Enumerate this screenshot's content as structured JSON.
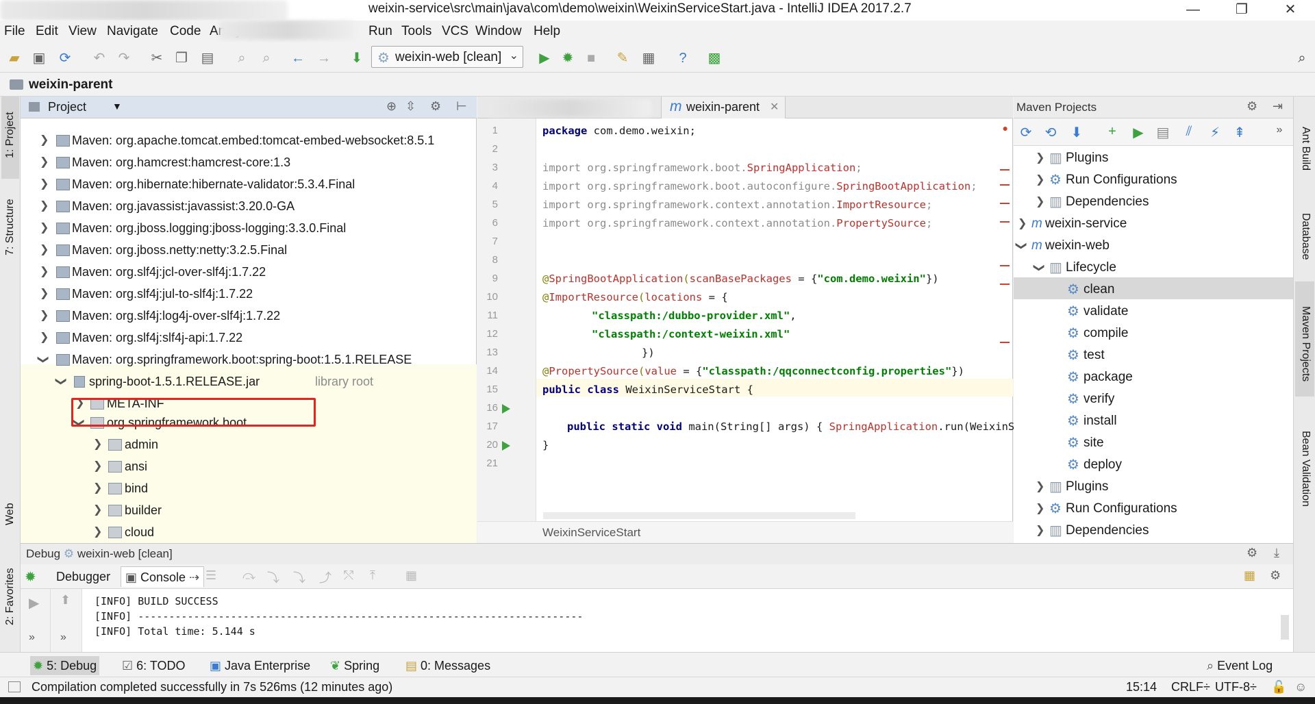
{
  "window": {
    "title": "weixin-service\\src\\main\\java\\com\\demo\\weixin\\WeixinServiceStart.java - IntelliJ IDEA 2017.2.7",
    "minimize": "—",
    "maximize": "❐",
    "close": "✕"
  },
  "menu": {
    "items": [
      "File",
      "Edit",
      "View",
      "Navigate",
      "Code",
      "Analyze",
      "Run",
      "Tools",
      "VCS",
      "Window",
      "Help"
    ]
  },
  "toolbar": {
    "run_config": "weixin-web [clean]"
  },
  "navbar": {
    "crumb": "weixin-parent"
  },
  "left_strip": {
    "project": "1: Project",
    "structure": "7: Structure",
    "web": "Web",
    "favorites": "2: Favorites"
  },
  "right_strip": {
    "ant": "Ant Build",
    "database": "Database",
    "maven": "Maven Projects",
    "bean": "Bean Validation"
  },
  "project": {
    "title": "Project",
    "rows": [
      {
        "label": "Maven: org.apache.tomcat.embed:tomcat-embed-websocket:8.5.1"
      },
      {
        "label": "Maven: org.hamcrest:hamcrest-core:1.3"
      },
      {
        "label": "Maven: org.hibernate:hibernate-validator:5.3.4.Final"
      },
      {
        "label": "Maven: org.javassist:javassist:3.20.0-GA"
      },
      {
        "label": "Maven: org.jboss.logging:jboss-logging:3.3.0.Final"
      },
      {
        "label": "Maven: org.jboss.netty:netty:3.2.5.Final"
      },
      {
        "label": "Maven: org.slf4j:jcl-over-slf4j:1.7.22"
      },
      {
        "label": "Maven: org.slf4j:jul-to-slf4j:1.7.22"
      },
      {
        "label": "Maven: org.slf4j:log4j-over-slf4j:1.7.22"
      },
      {
        "label": "Maven: org.slf4j:slf4j-api:1.7.22"
      },
      {
        "label": "Maven: org.springframework.boot:spring-boot:1.5.1.RELEASE"
      },
      {
        "label": "spring-boot-1.5.1.RELEASE.jar",
        "hint": "library root"
      },
      {
        "label": "META-INF"
      },
      {
        "label": "org.springframework.boot"
      },
      {
        "label": "admin"
      },
      {
        "label": "ansi"
      },
      {
        "label": "bind"
      },
      {
        "label": "builder"
      },
      {
        "label": "cloud"
      }
    ]
  },
  "editor": {
    "tab": "weixin-parent",
    "tab_icon": "m",
    "line_numbers": [
      "1",
      "2",
      "3",
      "4",
      "5",
      "6",
      "7",
      "8",
      "9",
      "10",
      "11",
      "12",
      "13",
      "14",
      "15",
      "16",
      "17",
      "20",
      "21"
    ],
    "breadcrumb": "WeixinServiceStart",
    "code": {
      "l1a": "package",
      "l1b": " com.demo.weixin;",
      "l3a": "import",
      "l3b": " org.springframework.boot.",
      "l3c": "SpringApplication",
      "l4a": "import",
      "l4b": " org.springframework.boot.autoconfigure.",
      "l4c": "SpringBootApplication",
      "l5a": "import",
      "l5b": " org.springframework.context.annotation.",
      "l5c": "ImportResource",
      "l6a": "import",
      "l6b": " org.springframework.context.annotation.",
      "l6c": "PropertySource",
      "semi": ";",
      "l9a": "@",
      "l9b": "SpringBootApplication",
      "l9c": "(",
      "l9d": "scanBasePackages",
      "l9e": " = {",
      "l9f": "\"com.demo.weixin\"",
      "l9g": "})",
      "l10a": "@",
      "l10b": "ImportResource",
      "l10c": "(",
      "l10d": "locations",
      "l10e": " = {",
      "l11": "\"classpath:/dubbo-provider.xml\"",
      "l11b": ",",
      "l12": "\"classpath:/context-weixin.xml\"",
      "l13": "})",
      "l14a": "@",
      "l14b": "PropertySource",
      "l14c": "(",
      "l14d": "value",
      "l14e": " = {",
      "l14f": "\"classpath:/qqconnectconfig.properties\"",
      "l14g": "})",
      "l15a": "public class",
      "l15b": " WeixinServiceStart",
      "l15c": " {",
      "l17a": "public static void",
      "l17b": " main(String[] args) ",
      "l17c": "{ ",
      "l17d": "SpringApplication",
      "l17e": ".run(",
      "l17f": "WeixinS",
      "l20": "}"
    }
  },
  "maven": {
    "title": "Maven Projects",
    "rows": [
      {
        "label": "Plugins"
      },
      {
        "label": "Run Configurations"
      },
      {
        "label": "Dependencies"
      },
      {
        "label": "weixin-service"
      },
      {
        "label": "weixin-web"
      },
      {
        "label": "Lifecycle"
      },
      {
        "label": "clean"
      },
      {
        "label": "validate"
      },
      {
        "label": "compile"
      },
      {
        "label": "test"
      },
      {
        "label": "package"
      },
      {
        "label": "verify"
      },
      {
        "label": "install"
      },
      {
        "label": "site"
      },
      {
        "label": "deploy"
      },
      {
        "label": "Plugins"
      },
      {
        "label": "Run Configurations"
      },
      {
        "label": "Dependencies"
      }
    ],
    "module_icon": "m"
  },
  "debug": {
    "title": "Debug",
    "config": "weixin-web [clean]",
    "tab_debugger": "Debugger",
    "tab_console": "Console",
    "console": [
      "[INFO] BUILD SUCCESS",
      "[INFO] ------------------------------------------------------------------------",
      "[INFO] Total time: 5.144 s"
    ]
  },
  "bottom_tabs": {
    "debug": "5: Debug",
    "todo": "6: TODO",
    "java_ee": "Java Enterprise",
    "spring": "Spring",
    "messages": "0: Messages",
    "event_log": "Event Log"
  },
  "status": {
    "message": "Compilation completed successfully in 7s 526ms (12 minutes ago)",
    "position": "15:14",
    "line_sep": "CRLF÷",
    "encoding": "UTF-8÷"
  },
  "colors": {
    "highlight": "#e8231e",
    "accent": "#3a7bd5",
    "run_green": "#3ea33e"
  }
}
